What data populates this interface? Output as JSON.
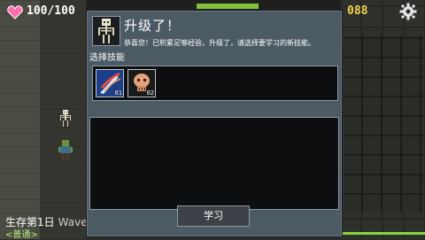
{
  "hud": {
    "hp": "100/100",
    "gold": "088",
    "survival_day": "生存第1日",
    "wave": "Wave",
    "mode": "<普通>"
  },
  "dialog": {
    "title": "升级了！",
    "description": "恭喜您！已积累足够经验，升级了，请选择要学习的新技能。",
    "section_label": "选择技能",
    "skills": [
      {
        "icon": "sword-slash-skill-icon",
        "level": "01"
      },
      {
        "icon": "skull-skill-icon",
        "level": "02"
      }
    ],
    "learn_button": "学习"
  },
  "colors": {
    "dialog_bg": "#4c5a64",
    "panel_bg": "#0d0e0f",
    "heart": "#ff6fae",
    "gold": "#f2d34a",
    "accent_green": "#8ad43a"
  }
}
